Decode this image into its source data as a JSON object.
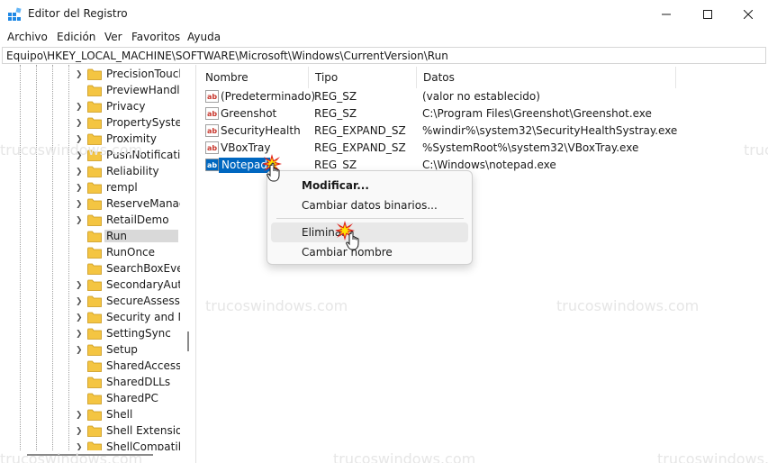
{
  "window": {
    "title": "Editor del Registro",
    "icon": "registry-editor-icon",
    "controls": {
      "minimize": "minimize-icon",
      "maximize": "maximize-icon",
      "close": "close-icon"
    }
  },
  "menu": {
    "items": [
      "Archivo",
      "Edición",
      "Ver",
      "Favoritos",
      "Ayuda"
    ]
  },
  "address": {
    "path": "Equipo\\HKEY_LOCAL_MACHINE\\SOFTWARE\\Microsoft\\Windows\\CurrentVersion\\Run"
  },
  "tree": {
    "items": [
      {
        "label": "PrecisionTouch",
        "expander": true,
        "selected": false
      },
      {
        "label": "PreviewHandle",
        "expander": false,
        "selected": false
      },
      {
        "label": "Privacy",
        "expander": true,
        "selected": false
      },
      {
        "label": "PropertySystem",
        "expander": true,
        "selected": false
      },
      {
        "label": "Proximity",
        "expander": true,
        "selected": false
      },
      {
        "label": "PushNotificati",
        "expander": true,
        "selected": false
      },
      {
        "label": "Reliability",
        "expander": true,
        "selected": false
      },
      {
        "label": "rempl",
        "expander": true,
        "selected": false
      },
      {
        "label": "ReserveManage",
        "expander": true,
        "selected": false
      },
      {
        "label": "RetailDemo",
        "expander": true,
        "selected": false
      },
      {
        "label": "Run",
        "expander": false,
        "selected": true
      },
      {
        "label": "RunOnce",
        "expander": false,
        "selected": false
      },
      {
        "label": "SearchBoxEven",
        "expander": false,
        "selected": false
      },
      {
        "label": "SecondaryAuth",
        "expander": true,
        "selected": false
      },
      {
        "label": "SecureAssessm",
        "expander": true,
        "selected": false
      },
      {
        "label": "Security and M",
        "expander": true,
        "selected": false
      },
      {
        "label": "SettingSync",
        "expander": true,
        "selected": false
      },
      {
        "label": "Setup",
        "expander": true,
        "selected": false
      },
      {
        "label": "SharedAccess",
        "expander": false,
        "selected": false
      },
      {
        "label": "SharedDLLs",
        "expander": false,
        "selected": false
      },
      {
        "label": "SharedPC",
        "expander": false,
        "selected": false
      },
      {
        "label": "Shell",
        "expander": true,
        "selected": false
      },
      {
        "label": "Shell Extension",
        "expander": true,
        "selected": false
      },
      {
        "label": "ShellCompatibi",
        "expander": true,
        "selected": false
      }
    ]
  },
  "list": {
    "columns": [
      "Nombre",
      "Tipo",
      "Datos"
    ],
    "rows": [
      {
        "name": "(Predeterminado)",
        "type": "REG_SZ",
        "data": "(valor no establecido)",
        "selected": false
      },
      {
        "name": "Greenshot",
        "type": "REG_SZ",
        "data": "C:\\Program Files\\Greenshot\\Greenshot.exe",
        "selected": false
      },
      {
        "name": "SecurityHealth",
        "type": "REG_EXPAND_SZ",
        "data": "%windir%\\system32\\SecurityHealthSystray.exe",
        "selected": false
      },
      {
        "name": "VBoxTray",
        "type": "REG_EXPAND_SZ",
        "data": "%SystemRoot%\\system32\\VBoxTray.exe",
        "selected": false
      },
      {
        "name": "Notepad",
        "type": "REG_SZ",
        "data": "C:\\Windows\\notepad.exe",
        "selected": true
      }
    ]
  },
  "context_menu": {
    "items": [
      {
        "label": "Modificar...",
        "bold": true,
        "hover": false
      },
      {
        "label": "Cambiar datos binarios...",
        "bold": false,
        "hover": false
      },
      {
        "label": "Eliminar",
        "bold": false,
        "hover": true
      },
      {
        "label": "Cambiar nombre",
        "bold": false,
        "hover": false
      }
    ]
  },
  "watermark": "trucoswindows.com",
  "colors": {
    "selection": "#0067c0",
    "folder": "#f4c542",
    "value_icon_red": "#c8372d",
    "burst_red": "#e0201b",
    "burst_yellow": "#ffe100"
  }
}
